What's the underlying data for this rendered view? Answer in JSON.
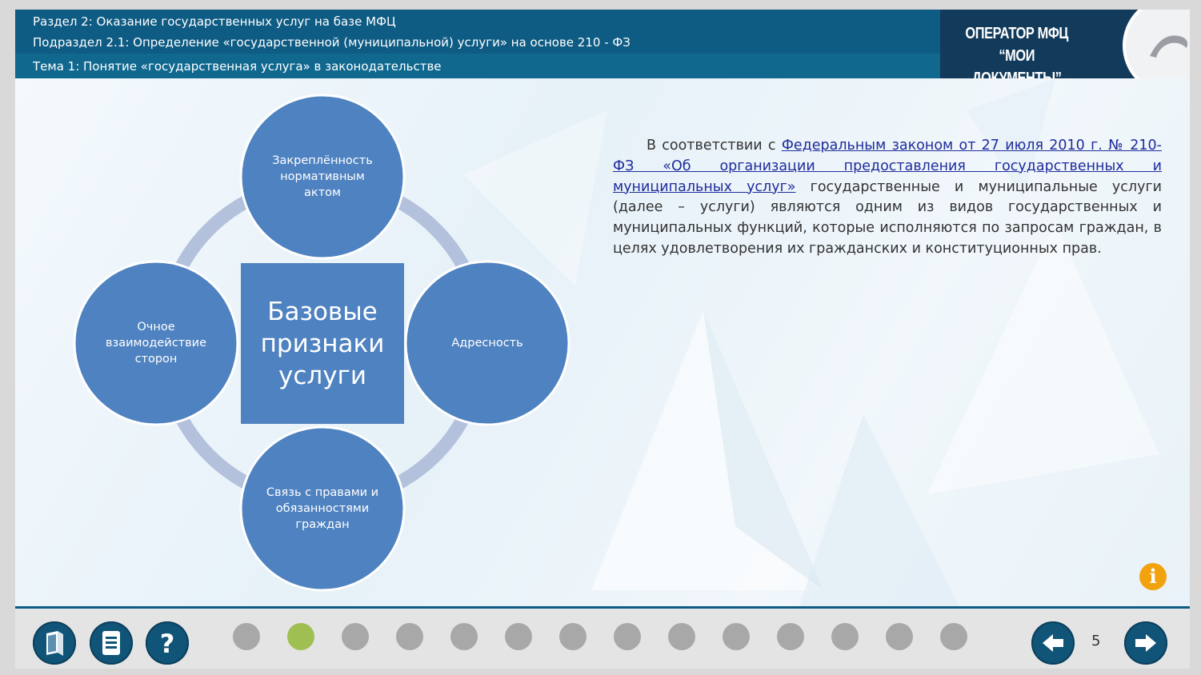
{
  "header": {
    "section": "Раздел 2: Оказание государственных услуг на базе МФЦ",
    "subsection": "Подраздел 2.1: Определение «государственной (муниципальной) услуги» на основе 210 - ФЗ",
    "topic": "Тема 1: Понятие «государственная услуга» в законодательстве",
    "logo_line1": "ОПЕРАТОР МФЦ",
    "logo_line2": "“МОИ ДОКУМЕНТЫ”"
  },
  "diagram": {
    "center": "Базовые признаки услуги",
    "top": "Закреплённость нормативным актом",
    "right": "Адресность",
    "bottom": "Связь с правами и обязанностями граждан",
    "left": "Очное взаимодействие сторон"
  },
  "paragraph": {
    "prefix": "В соответствии с ",
    "link": "Федеральным законом от 27 июля 2010 г. № 210-ФЗ «Об организации предоставления государственных и муниципальных услуг»",
    "suffix": " государственные и муниципальные услуги (далее – услуги) являются одним из видов государственных  и муниципальных функций, которые исполняются по запросам граждан, в целях удовлетворения их гражданских и конституционных прав."
  },
  "footer": {
    "page_number": "5",
    "total_dots": 14,
    "active_dot": 2
  },
  "colors": {
    "header": "#0e5b83",
    "circle": "#4f82c0",
    "ring": "#b3c1dc",
    "dot_active": "#9fbf52",
    "dot_inactive": "#a8a8a8",
    "info": "#f2a20d"
  },
  "icons": [
    "book-icon",
    "list-icon",
    "help-icon",
    "arrow-left-icon",
    "arrow-right-icon",
    "info-icon",
    "logo-arc-icon"
  ]
}
